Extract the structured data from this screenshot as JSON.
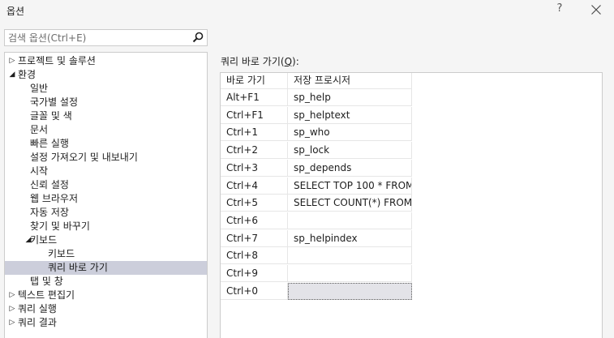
{
  "window": {
    "title": "옵션",
    "help_label": "?",
    "close_label": "✕"
  },
  "search": {
    "placeholder": "검색 옵션(Ctrl+E)",
    "value": ""
  },
  "tree": [
    {
      "label": "프로젝트 및 솔루션",
      "level": 0,
      "toggle": "▷"
    },
    {
      "label": "환경",
      "level": 0,
      "toggle": "◢"
    },
    {
      "label": "일반",
      "level": 1
    },
    {
      "label": "국가별 설정",
      "level": 1
    },
    {
      "label": "글꼴 및 색",
      "level": 1
    },
    {
      "label": "문서",
      "level": 1
    },
    {
      "label": "빠른 실행",
      "level": 1
    },
    {
      "label": "설정 가져오기 및 내보내기",
      "level": 1
    },
    {
      "label": "시작",
      "level": 1
    },
    {
      "label": "신뢰 설정",
      "level": 1
    },
    {
      "label": "웹 브라우저",
      "level": 1
    },
    {
      "label": "자동 저장",
      "level": 1
    },
    {
      "label": "찾기 및 바꾸기",
      "level": 1
    },
    {
      "label": "키보드",
      "level": 1,
      "toggle": "◢"
    },
    {
      "label": "키보드",
      "level": 2
    },
    {
      "label": "쿼리 바로 가기",
      "level": 2,
      "selected": true
    },
    {
      "label": "탭 및 창",
      "level": 1
    },
    {
      "label": "텍스트 편집기",
      "level": 0,
      "toggle": "▷"
    },
    {
      "label": "쿼리 실행",
      "level": 0,
      "toggle": "▷"
    },
    {
      "label": "쿼리 결과",
      "level": 0,
      "toggle": "▷"
    }
  ],
  "shortcuts": {
    "label_prefix": "쿼리 바로 가기(",
    "label_key": "Q",
    "label_suffix": "):",
    "columns": [
      "바로 가기",
      "저장 프로시저"
    ],
    "rows": [
      {
        "key": "Alt+F1",
        "proc": "sp_help"
      },
      {
        "key": "Ctrl+F1",
        "proc": "sp_helptext"
      },
      {
        "key": "Ctrl+1",
        "proc": "sp_who"
      },
      {
        "key": "Ctrl+2",
        "proc": "sp_lock"
      },
      {
        "key": "Ctrl+3",
        "proc": "sp_depends"
      },
      {
        "key": "Ctrl+4",
        "proc": "SELECT TOP 100 * FROM"
      },
      {
        "key": "Ctrl+5",
        "proc": "SELECT COUNT(*) FROM"
      },
      {
        "key": "Ctrl+6",
        "proc": ""
      },
      {
        "key": "Ctrl+7",
        "proc": "sp_helpindex"
      },
      {
        "key": "Ctrl+8",
        "proc": ""
      },
      {
        "key": "Ctrl+9",
        "proc": ""
      },
      {
        "key": "Ctrl+0",
        "proc": "",
        "active": true
      }
    ]
  },
  "colors": {
    "selection": "#cccedb",
    "border": "#cccccc"
  }
}
